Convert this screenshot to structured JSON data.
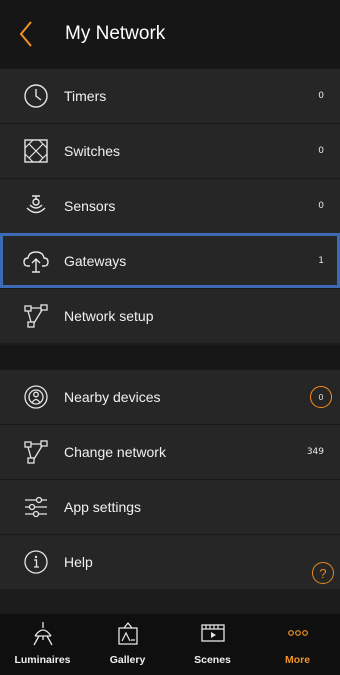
{
  "header": {
    "title": "My Network",
    "back_icon": "chevron-left-icon"
  },
  "colors": {
    "accent": "#F0922A",
    "selection": "#3D6AB5"
  },
  "network_items": [
    {
      "label": "Timers",
      "count": "0",
      "icon": "clock-icon"
    },
    {
      "label": "Switches",
      "count": "0",
      "icon": "switch-icon"
    },
    {
      "label": "Sensors",
      "count": "0",
      "icon": "sensor-icon"
    },
    {
      "label": "Gateways",
      "count": "1",
      "icon": "cloud-upload-icon",
      "selected": true
    },
    {
      "label": "Network setup",
      "count": "",
      "icon": "network-nodes-icon"
    }
  ],
  "other_items": [
    {
      "label": "Nearby devices",
      "count": "0",
      "icon": "nearby-icon"
    },
    {
      "label": "Change network",
      "count": "349",
      "icon": "network-nodes-icon"
    },
    {
      "label": "App settings",
      "count": "",
      "icon": "sliders-icon"
    },
    {
      "label": "Help",
      "count": "",
      "icon": "info-icon"
    }
  ],
  "help_fab": {
    "icon": "question-icon",
    "glyph": "?"
  },
  "tabs": [
    {
      "label": "Luminaires",
      "icon": "luminaire-icon",
      "active": false
    },
    {
      "label": "Gallery",
      "icon": "gallery-icon",
      "active": false
    },
    {
      "label": "Scenes",
      "icon": "scenes-icon",
      "active": false
    },
    {
      "label": "More",
      "icon": "more-icon",
      "active": true
    }
  ]
}
